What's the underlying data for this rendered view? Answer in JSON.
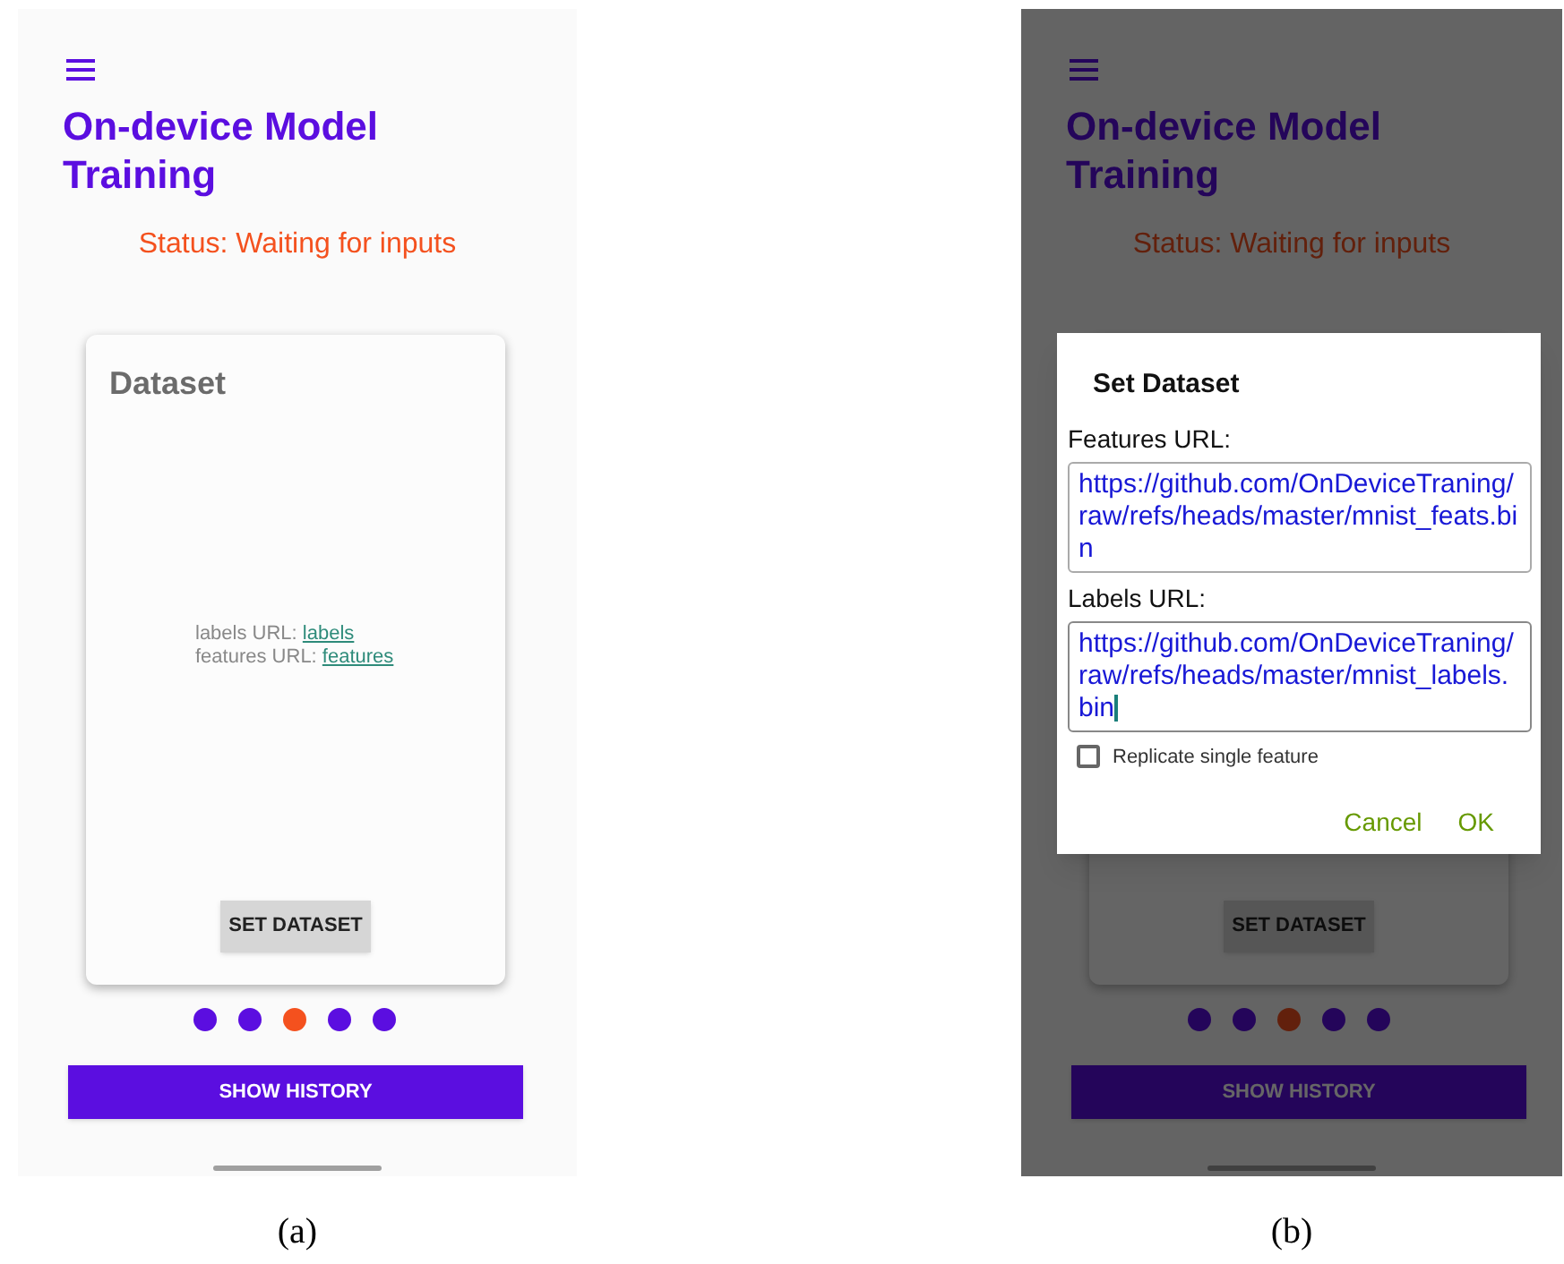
{
  "panels": [
    {
      "caption": "(a)",
      "dimmed": false,
      "screen": {
        "title": "On-device Model Training",
        "status": "Status: Waiting for inputs",
        "card": {
          "heading": "Dataset",
          "links": [
            {
              "label": "labels URL:",
              "link": "labels"
            },
            {
              "label": "features URL:",
              "link": "features"
            }
          ],
          "button": "SET DATASET"
        },
        "dots": [
          {
            "selected": false
          },
          {
            "selected": false
          },
          {
            "selected": true
          },
          {
            "selected": false
          },
          {
            "selected": false
          }
        ],
        "history_button": "SHOW HISTORY"
      }
    },
    {
      "caption": "(b)",
      "dimmed": true,
      "screen": {
        "title": "On-device Model Training",
        "status": "Status: Waiting for inputs",
        "card": {
          "button": "SET DATASET"
        },
        "dots": [
          {
            "selected": false
          },
          {
            "selected": false
          },
          {
            "selected": true
          },
          {
            "selected": false
          },
          {
            "selected": false
          }
        ],
        "history_button": "SHOW HISTORY"
      },
      "dialog": {
        "title": "Set Dataset",
        "fields": [
          {
            "label": "Features URL:",
            "value": "https://github.com/OnDeviceTraning/raw/refs/heads/master/mnist_feats.bin",
            "focused": false
          },
          {
            "label": "Labels URL:",
            "value": "https://github.com/OnDeviceTraning/raw/refs/heads/master/mnist_labels.bin",
            "focused": true
          }
        ],
        "checkbox": {
          "label": "Replicate single feature",
          "checked": false
        },
        "buttons": [
          "Cancel",
          "OK"
        ]
      }
    }
  ]
}
